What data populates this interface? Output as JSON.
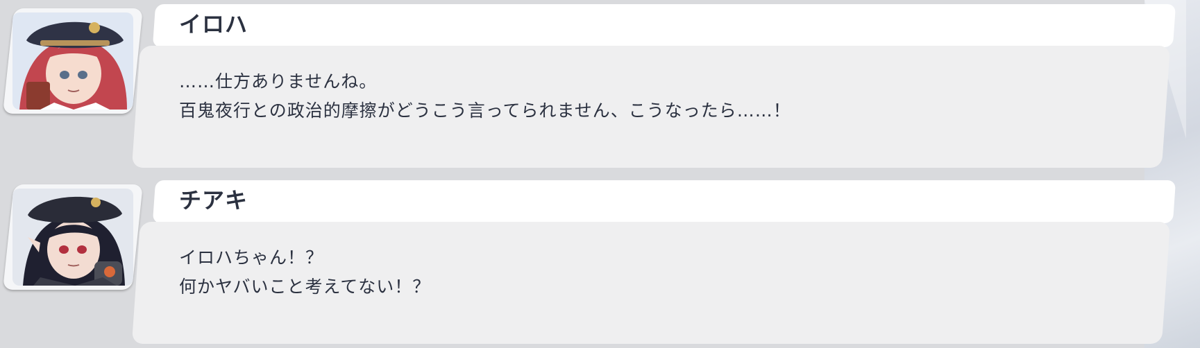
{
  "messages": [
    {
      "speaker": "イロハ",
      "lines": [
        "……仕方ありませんね。",
        "百鬼夜行との政治的摩擦がどうこう言ってられません、こうなったら……！"
      ],
      "avatar": "character-portrait-iroha",
      "colors": {
        "hair": "#c2464f",
        "hat": "#2f3346",
        "skin": "#f6dccf"
      }
    },
    {
      "speaker": "チアキ",
      "lines": [
        "イロハちゃん！？",
        "何かヤバいこと考えてない！？"
      ],
      "avatar": "character-portrait-chiaki",
      "colors": {
        "hair": "#1f2030",
        "hat": "#2a2c38",
        "skin": "#f3dcd2"
      }
    }
  ]
}
